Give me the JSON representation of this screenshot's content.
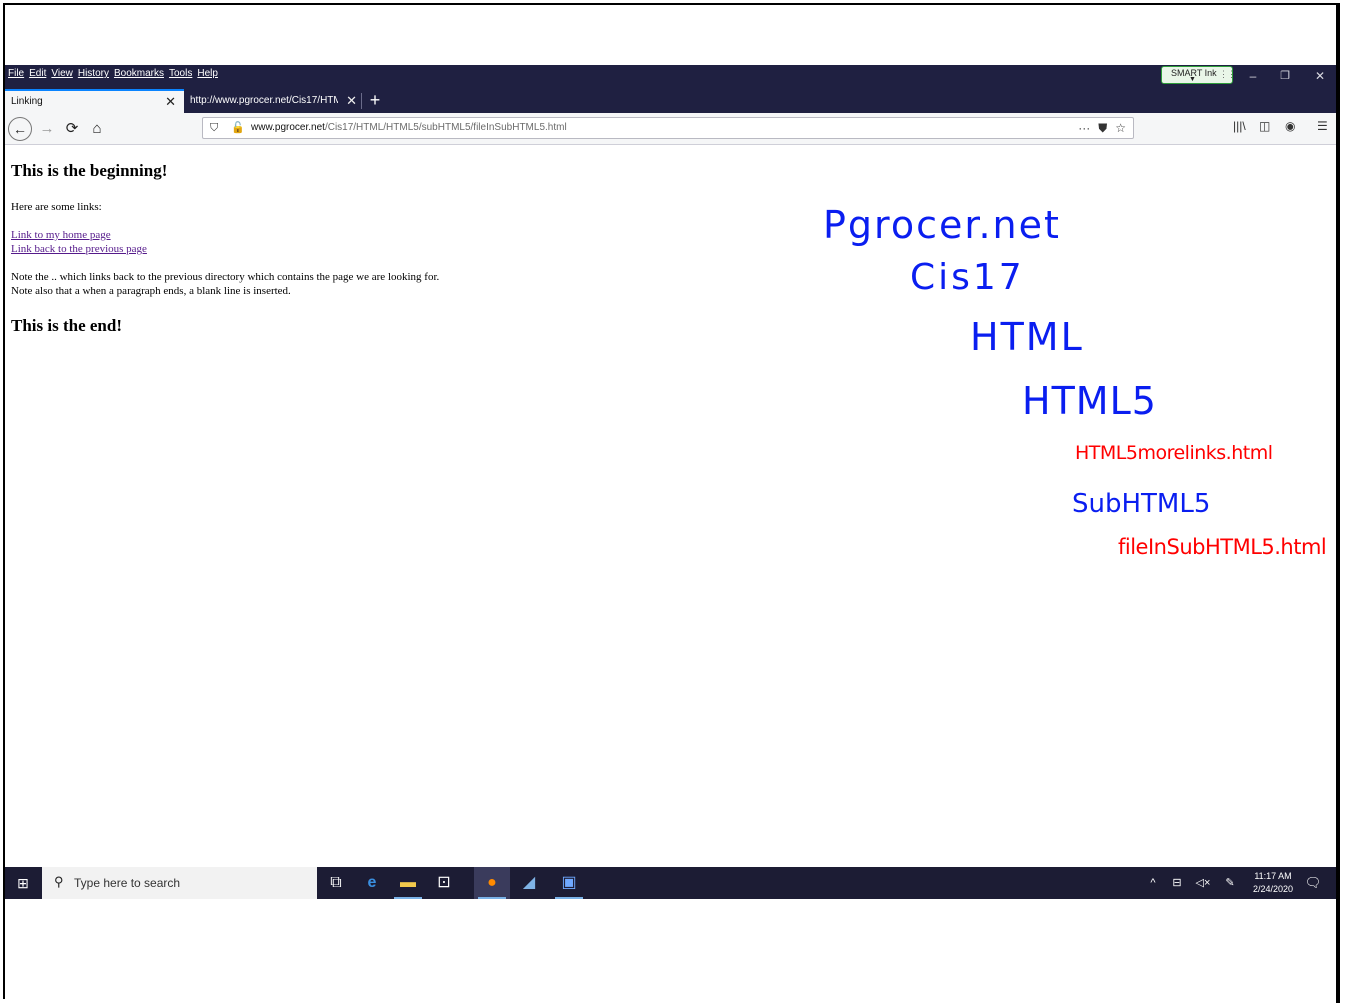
{
  "menubar": {
    "items": [
      "File",
      "Edit",
      "View",
      "History",
      "Bookmarks",
      "Tools",
      "Help"
    ],
    "smart_ink_label": "SMART Ink"
  },
  "window_controls": {
    "minimize": "–",
    "restore": "❐",
    "close": "✕"
  },
  "tabs": [
    {
      "title": "Linking",
      "active": true
    },
    {
      "title": "http://www.pgrocer.net/Cis17/HTM",
      "active": false
    }
  ],
  "new_tab_symbol": "+",
  "navbar": {
    "url_host": "www.pgrocer.net",
    "url_path": "/Cis17/HTML/HTML5/subHTML5/fileInSubHTML5.html",
    "page_actions_symbol": "···"
  },
  "page": {
    "heading_start": "This is the beginning!",
    "intro": "Here are some links:",
    "link_home": "Link to my home page",
    "link_previous": "Link back to the previous page",
    "note_1": "Note the .. which links back to the previous directory which contains the page we are looking for.",
    "note_2": "Note also that a when a paragraph ends, a blank line is inserted.",
    "heading_end": "This is the end!"
  },
  "annotations": {
    "line1": "Pgrocer.net",
    "line2": "Cis17",
    "line3": "HTML",
    "line4": "HTML5",
    "line5": "HTML5morelinks.html",
    "line6": "SubHTML5",
    "line7": "fileInSubHTML5.html"
  },
  "colors": {
    "chrome_dark": "#1f2041",
    "ink_blue": "#0a1ef0",
    "ink_red": "#ff0000",
    "visited_link": "#551a8b"
  },
  "taskbar": {
    "search_placeholder": "Type here to search",
    "time": "11:17 AM",
    "date": "2/24/2020"
  }
}
